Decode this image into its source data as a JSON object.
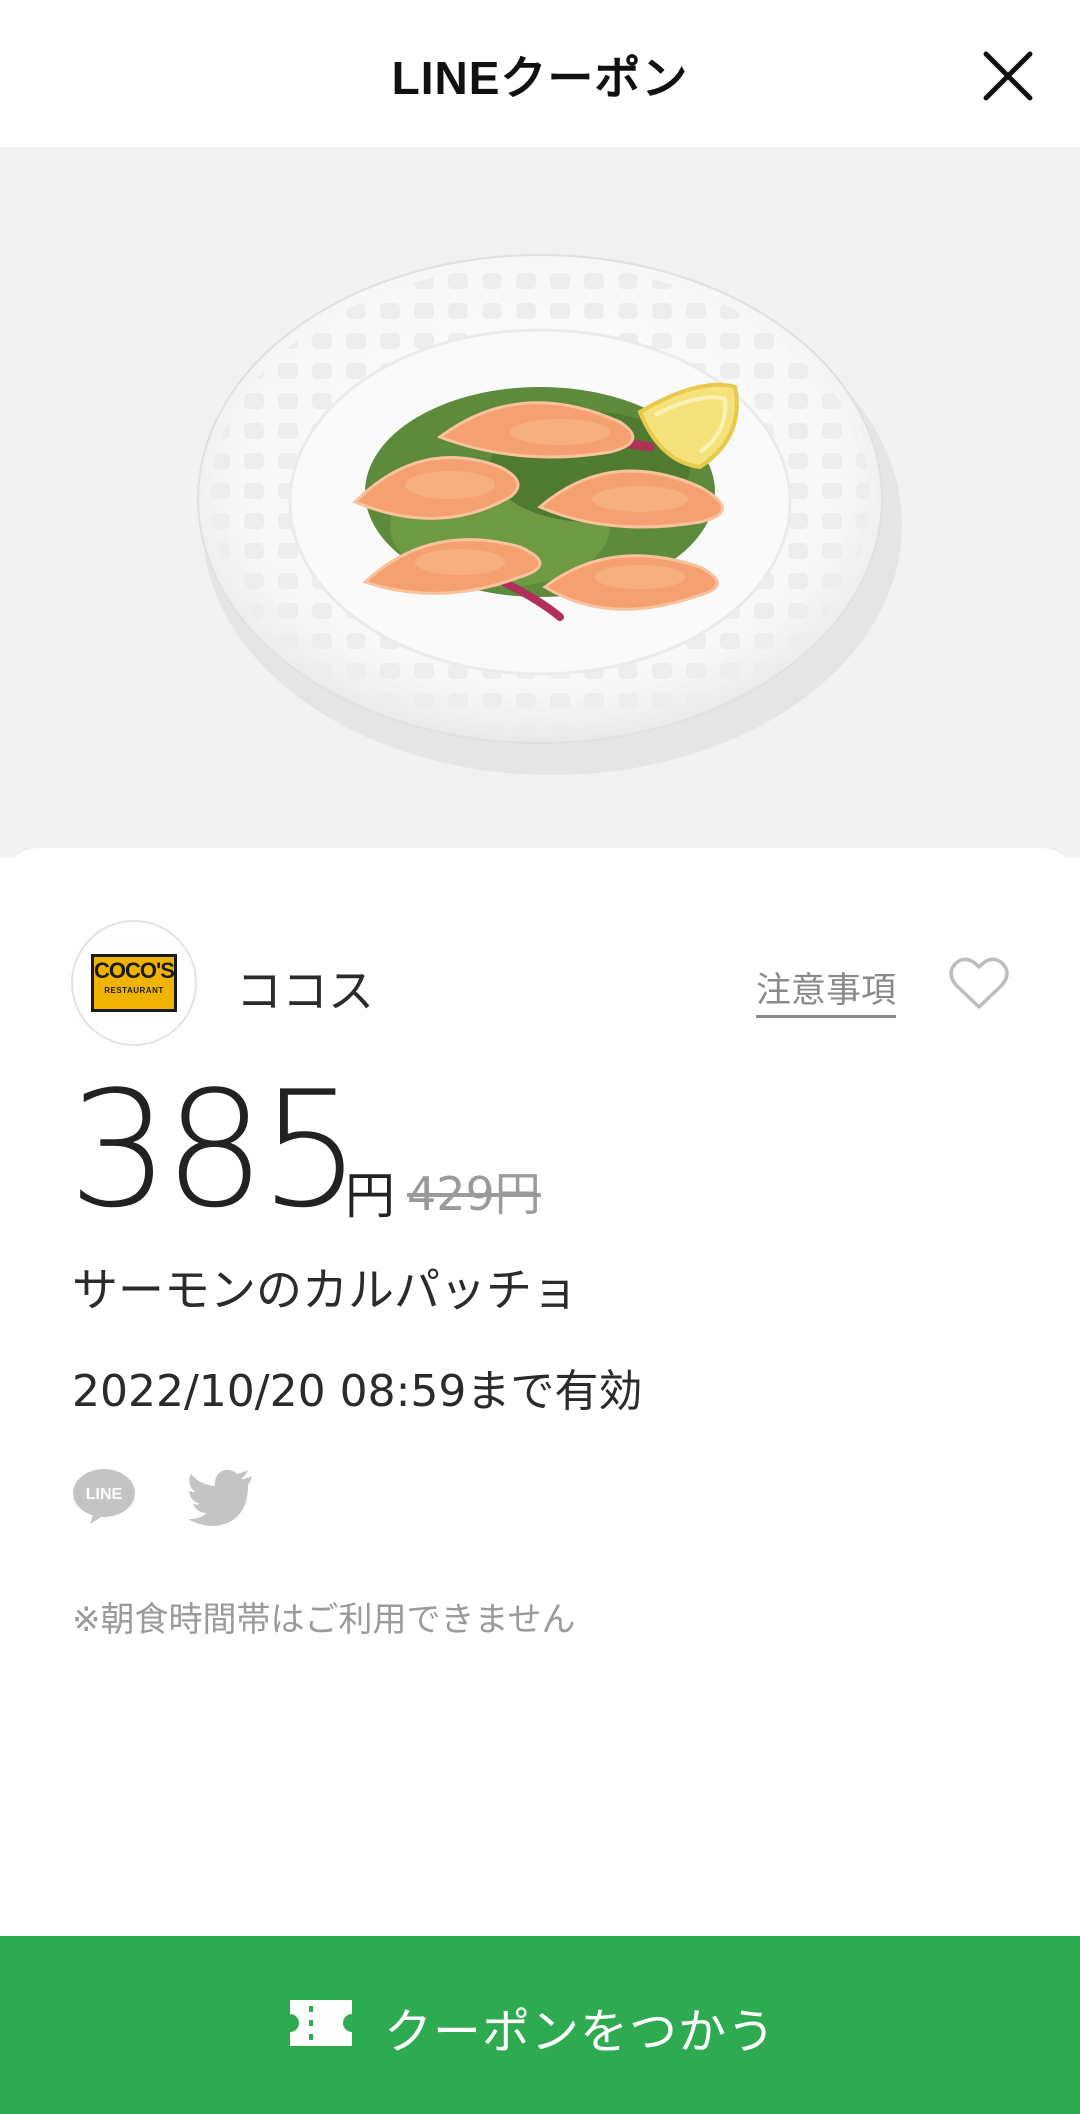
{
  "header": {
    "title": "LINEクーポン"
  },
  "store": {
    "logo_line1": "COCO'S",
    "logo_line2": "RESTAURANT",
    "name": "ココス",
    "notes_label": "注意事項"
  },
  "coupon": {
    "price": "385",
    "price_unit": "円",
    "original_price": "429円",
    "item_name": "サーモンのカルパッチョ",
    "validity": "2022/10/20  08:59まで有効",
    "note": "※朝食時間帯はご利用できません"
  },
  "share": {
    "line_icon_text": "LINE"
  },
  "action": {
    "use_label": "クーポンをつかう"
  },
  "colors": {
    "accent_green": "#2eaa51",
    "hero_bg": "#f1f1f1",
    "logo_yellow": "#f0b400"
  }
}
